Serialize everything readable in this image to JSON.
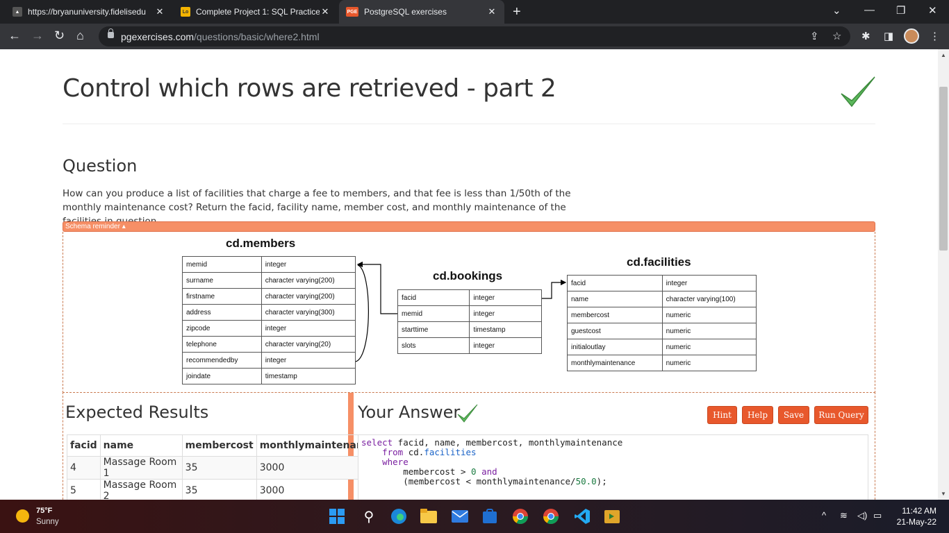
{
  "browser": {
    "tabs": [
      {
        "title": "https://bryanuniversity.fidelisedu",
        "favicon": "mountain-icon"
      },
      {
        "title": "Complete Project 1: SQL Practice",
        "favicon": "doc-icon"
      },
      {
        "title": "PostgreSQL exercises",
        "favicon": "pge-icon"
      }
    ],
    "url_domain": "pgexercises.com",
    "url_path": "/questions/basic/where2.html"
  },
  "page": {
    "title": "Control which rows are retrieved - part 2",
    "question_heading": "Question",
    "question_text": "How can you produce a list of facilities that charge a fee to members, and that fee is less than 1/50th of the monthly maintenance cost? Return the facid, facility name, member cost, and monthly maintenance of the facilities in question.",
    "schema_reminder": "Schema reminder ▴",
    "schema": {
      "members": {
        "title": "cd.members",
        "rows": [
          [
            "memid",
            "integer"
          ],
          [
            "surname",
            "character varying(200)"
          ],
          [
            "firstname",
            "character varying(200)"
          ],
          [
            "address",
            "character varying(300)"
          ],
          [
            "zipcode",
            "integer"
          ],
          [
            "telephone",
            "character varying(20)"
          ],
          [
            "recommendedby",
            "integer"
          ],
          [
            "joindate",
            "timestamp"
          ]
        ]
      },
      "bookings": {
        "title": "cd.bookings",
        "rows": [
          [
            "facid",
            "integer"
          ],
          [
            "memid",
            "integer"
          ],
          [
            "starttime",
            "timestamp"
          ],
          [
            "slots",
            "integer"
          ]
        ]
      },
      "facilities": {
        "title": "cd.facilities",
        "rows": [
          [
            "facid",
            "integer"
          ],
          [
            "name",
            "character varying(100)"
          ],
          [
            "membercost",
            "numeric"
          ],
          [
            "guestcost",
            "numeric"
          ],
          [
            "initialoutlay",
            "numeric"
          ],
          [
            "monthlymaintenance",
            "numeric"
          ]
        ]
      }
    },
    "expected_heading": "Expected Results",
    "results": {
      "headers": [
        "facid",
        "name",
        "membercost",
        "monthlymaintenance"
      ],
      "rows": [
        [
          "4",
          "Massage Room 1",
          "35",
          "3000"
        ],
        [
          "5",
          "Massage Room 2",
          "35",
          "3000"
        ]
      ]
    },
    "answer_heading": "Your Answer",
    "buttons": {
      "hint": "Hint",
      "help": "Help",
      "save": "Save",
      "run": "Run Query"
    }
  },
  "taskbar": {
    "temperature": "75°F",
    "weather": "Sunny",
    "time": "11:42 AM",
    "date": "21-May-22"
  }
}
